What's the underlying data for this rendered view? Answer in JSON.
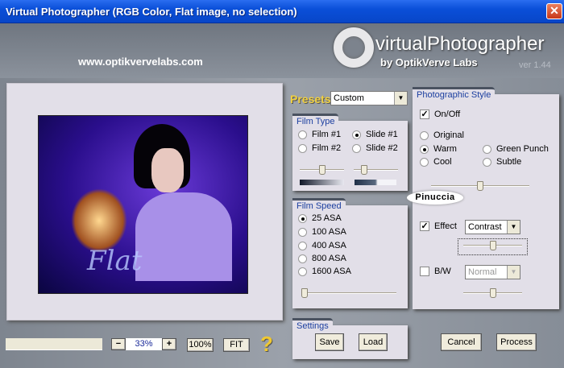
{
  "window": {
    "title": "Virtual Photographer (RGB Color, Flat image, no selection)",
    "close": "✕"
  },
  "header": {
    "url": "www.optikvervelabs.com",
    "logo_text": "virtualPhotographer",
    "logo_by": "by OptikVerve Labs",
    "version": "ver 1.44"
  },
  "presets": {
    "label": "Presets",
    "value": "Custom"
  },
  "film_type": {
    "title": "Film Type",
    "options": [
      {
        "label": "Film #1",
        "selected": false
      },
      {
        "label": "Slide #1",
        "selected": true
      },
      {
        "label": "Film #2",
        "selected": false
      },
      {
        "label": "Slide #2",
        "selected": false
      }
    ],
    "slider1": 0.5,
    "slider2": 0.2
  },
  "film_speed": {
    "title": "Film Speed",
    "options": [
      {
        "label": "25 ASA",
        "selected": true
      },
      {
        "label": "100 ASA",
        "selected": false
      },
      {
        "label": "400 ASA",
        "selected": false
      },
      {
        "label": "800 ASA",
        "selected": false
      },
      {
        "label": "1600 ASA",
        "selected": false
      }
    ],
    "slider": 0
  },
  "style": {
    "title": "Photographic Style",
    "onoff_label": "On/Off",
    "onoff": true,
    "options": [
      {
        "label": "Original",
        "selected": false
      },
      {
        "label": "Warm",
        "selected": true
      },
      {
        "label": "Green Punch",
        "selected": false
      },
      {
        "label": "Cool",
        "selected": false
      },
      {
        "label": "Subtle",
        "selected": false
      }
    ],
    "slider": 0.5,
    "watermark": "Pinuccia",
    "effect_label": "Effect",
    "effect_checked": true,
    "effect_value": "Contrast",
    "effect_slider": 0.5,
    "bw_label": "B/W",
    "bw_checked": false,
    "bw_value": "Normal",
    "bw_slider": 0.5
  },
  "settings": {
    "title": "Settings",
    "save": "Save",
    "load": "Load"
  },
  "actions": {
    "cancel": "Cancel",
    "process": "Process"
  },
  "zoom": {
    "minus": "−",
    "value": "33%",
    "plus": "+",
    "full": "100%",
    "fit": "FIT",
    "help": "?"
  },
  "image": {
    "caption": "Flat"
  }
}
